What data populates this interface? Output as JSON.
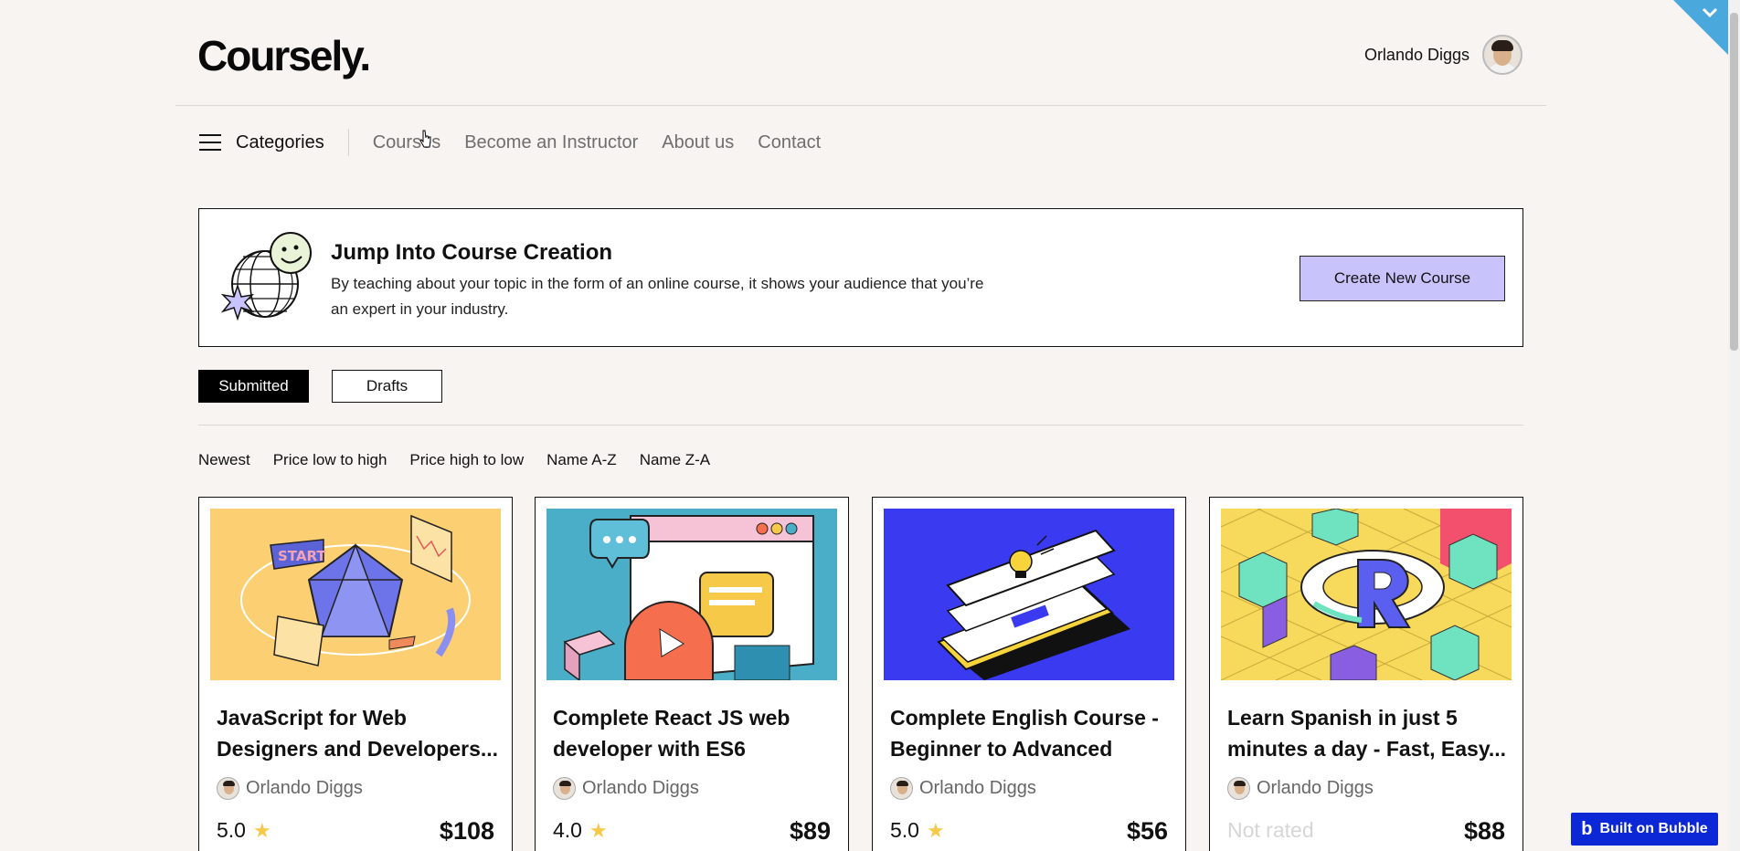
{
  "header": {
    "logo": "Coursely.",
    "user_name": "Orlando Diggs"
  },
  "nav": {
    "categories_label": "Categories",
    "links": [
      "Courses",
      "Become an Instructor",
      "About us",
      "Contact"
    ]
  },
  "banner": {
    "title": "Jump Into Course Creation",
    "text": "By teaching about your topic in the form of an online course, it shows your audience that you’re an expert in your industry.",
    "button_label": "Create New Course"
  },
  "tabs": {
    "submitted": "Submitted",
    "drafts": "Drafts",
    "active": "Submitted"
  },
  "sort_options": [
    "Newest",
    "Price low to high",
    "Price high to low",
    "Name A-Z",
    "Name Z-A"
  ],
  "courses": [
    {
      "title": "JavaScript for Web Designers and Developers...",
      "author": "Orlando Diggs",
      "rating": "5.0",
      "price": "$108"
    },
    {
      "title": "Complete React JS web developer with ES6",
      "author": "Orlando Diggs",
      "rating": "4.0",
      "price": "$89"
    },
    {
      "title": "Complete English Course - Beginner to Advanced",
      "author": "Orlando Diggs",
      "rating": "5.0",
      "price": "$56"
    },
    {
      "title": "Learn Spanish in just 5 minutes a day - Fast, Easy...",
      "author": "Orlando Diggs",
      "rating": "Not rated",
      "price": "$88"
    }
  ],
  "badge": {
    "label": "Built on Bubble"
  },
  "colors": {
    "background": "#f7f4f1",
    "accent_button": "#c9c3fb",
    "star": "#f7c948",
    "bubble_badge": "#0b27d6",
    "corner_ribbon": "#4ba8dc"
  },
  "icons": {
    "menu": "hamburger-icon",
    "star": "star-icon",
    "corner": "chevron-down-icon"
  }
}
